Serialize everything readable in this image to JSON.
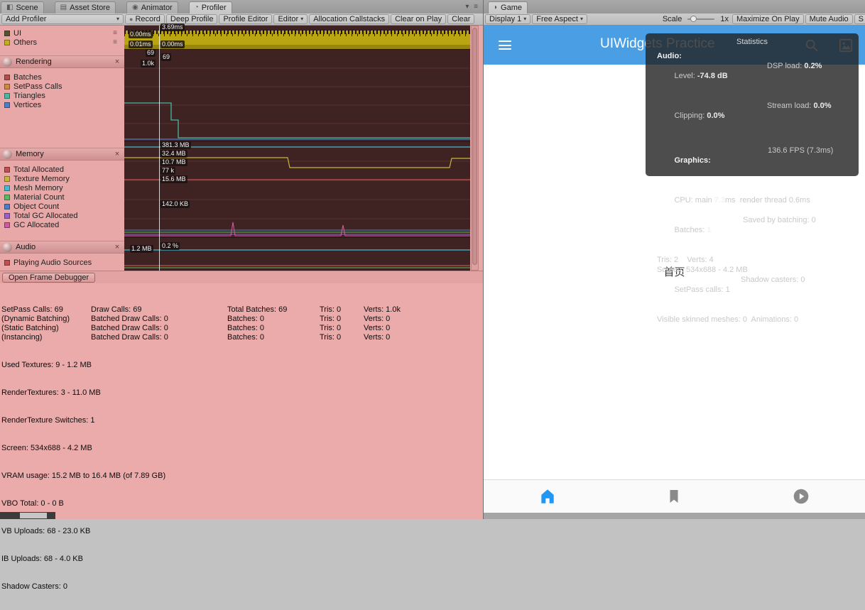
{
  "icons": {
    "scene_tab": "◧",
    "asset_store_tab": "▤",
    "animator_tab": "◉",
    "profiler_tab": "◔",
    "game_tab": "◗",
    "record_dot": "●",
    "dropdown_arrow": "▾",
    "close": "×",
    "drag_handle": "≡",
    "window_menu": "▾ ≡"
  },
  "tabs": {
    "left": [
      {
        "label": "Scene"
      },
      {
        "label": "Asset Store"
      },
      {
        "label": "Animator"
      },
      {
        "label": "Profiler"
      }
    ],
    "game": "Game"
  },
  "profiler_toolbar": {
    "add_profiler": "Add Profiler",
    "record": "Record",
    "deep_profile": "Deep Profile",
    "profile_editor": "Profile Editor",
    "editor": "Editor",
    "allocation_callstacks": "Allocation Callstacks",
    "clear_on_play": "Clear on Play",
    "clear": "Clear"
  },
  "game_toolbar": {
    "display": "Display 1",
    "aspect": "Free Aspect",
    "scale_label": "Scale",
    "scale_value": "1x",
    "maximize_on_play": "Maximize On Play",
    "mute_audio": "Mute Audio",
    "stats": "S"
  },
  "modules": {
    "cpu": {
      "legend": [
        {
          "label": "UI",
          "color": "#55542e"
        },
        {
          "label": "Others",
          "color": "#c3b11c"
        }
      ]
    },
    "rendering": {
      "title": "Rendering",
      "legend": [
        {
          "label": "Batches",
          "color": "#b0504e"
        },
        {
          "label": "SetPass Calls",
          "color": "#d1883f"
        },
        {
          "label": "Triangles",
          "color": "#47b99e"
        },
        {
          "label": "Vertices",
          "color": "#4d7ec8"
        }
      ]
    },
    "memory": {
      "title": "Memory",
      "legend": [
        {
          "label": "Total Allocated",
          "color": "#c34f4f"
        },
        {
          "label": "Texture Memory",
          "color": "#c8b53a"
        },
        {
          "label": "Mesh Memory",
          "color": "#42bcd1"
        },
        {
          "label": "Material Count",
          "color": "#55bd60"
        },
        {
          "label": "Object Count",
          "color": "#4d7ec8"
        },
        {
          "label": "Total GC Allocated",
          "color": "#9a5fc9"
        },
        {
          "label": "GC Allocated",
          "color": "#cb5b9e"
        }
      ]
    },
    "audio": {
      "title": "Audio",
      "legend": [
        {
          "label": "Playing Audio Sources",
          "color": "#c34f4f"
        }
      ]
    }
  },
  "chart_chips": [
    "0.00ms",
    "3.69ms",
    "0.01ms",
    "0.00ms",
    "69",
    "69",
    "1.0k",
    "381.3 MB",
    "32.4 MB",
    "10.7 MB",
    "77 k",
    "15.6 MB",
    "142.0 KB",
    "1.2 MB",
    "0.2 %"
  ],
  "open_frame_debugger": "Open Frame Debugger",
  "render_stats": {
    "rows": [
      [
        "SetPass Calls: 69",
        "Draw Calls: 69",
        "Total Batches: 69",
        "Tris: 0",
        "Verts: 1.0k"
      ],
      [
        "(Dynamic Batching)",
        "Batched Draw Calls: 0",
        "Batches: 0",
        "Tris: 0",
        "Verts: 0"
      ],
      [
        "(Static Batching)",
        "Batched Draw Calls: 0",
        "Batches: 0",
        "Tris: 0",
        "Verts: 0"
      ],
      [
        "(Instancing)",
        "Batched Draw Calls: 0",
        "Batches: 0",
        "Tris: 0",
        "Verts: 0"
      ]
    ],
    "lines": [
      "Used Textures: 9 - 1.2 MB",
      "RenderTextures: 3 - 11.0 MB",
      "RenderTexture Switches: 1",
      "Screen: 534x688 - 4.2 MB",
      "VRAM usage: 15.2 MB to 16.4 MB (of 7.89 GB)",
      "VBO Total: 0 - 0 B",
      "VB Uploads: 68 - 23.0 KB",
      "IB Uploads: 68 - 4.0 KB",
      "Shadow Casters: 0"
    ]
  },
  "app": {
    "title": "UIWidgets Practice",
    "body_text": "首页",
    "appbar_color": "#4a9fe4",
    "nav_active_color": "#2196f3",
    "nav_inactive_color": "#8a8a8a"
  },
  "statistics": {
    "title": "Statistics",
    "audio_header": "Audio:",
    "level_label": "Level:",
    "level_value": "-74.8 dB",
    "dsp_label": "DSP load:",
    "dsp_value": "0.2%",
    "clipping_label": "Clipping:",
    "clipping_value": "0.0%",
    "stream_label": "Stream load:",
    "stream_value": "0.0%",
    "graphics_header": "Graphics:",
    "fps": "136.6 FPS (7.3ms)",
    "cpu_prefix": "CPU: main ",
    "cpu_bold": "7.3",
    "cpu_suffix": "ms  render thread 0.6ms",
    "batches_prefix": "Batches: ",
    "batches_bold": "1",
    "saved_by_batching": "Saved by batching: 0",
    "tris_verts": "Tris: 2    Verts: 4",
    "screen": "Screen: 534x688 - 4.2 MB",
    "setpass": "SetPass calls: 1",
    "shadow_casters": "Shadow casters: 0",
    "skinned": "Visible skinned meshes: 0  Animations: 0"
  }
}
